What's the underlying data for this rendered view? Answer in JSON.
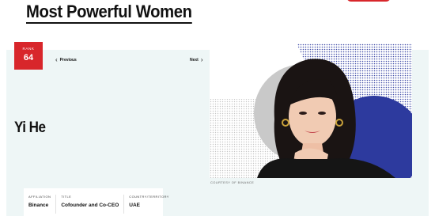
{
  "header": {
    "title": "Most Powerful Women"
  },
  "profile": {
    "rank_label": "RANK",
    "rank": "64",
    "prev_label": "Previous",
    "next_label": "Next",
    "name": "Yi He",
    "photo_credit": "COURTESY OF BINANCE"
  },
  "info": [
    {
      "label": "AFFILIATION",
      "value": "Binance"
    },
    {
      "label": "TITLE",
      "value": "Cofounder and Co-CEO"
    },
    {
      "label": "COUNTRY/TERRITORY",
      "value": "UAE"
    }
  ],
  "colors": {
    "accent": "#d8262b",
    "panel": "#eef6f6",
    "photo_blue": "#2d3a9e"
  },
  "icons": {
    "prev": "chevron-left-icon",
    "next": "chevron-right-icon"
  }
}
